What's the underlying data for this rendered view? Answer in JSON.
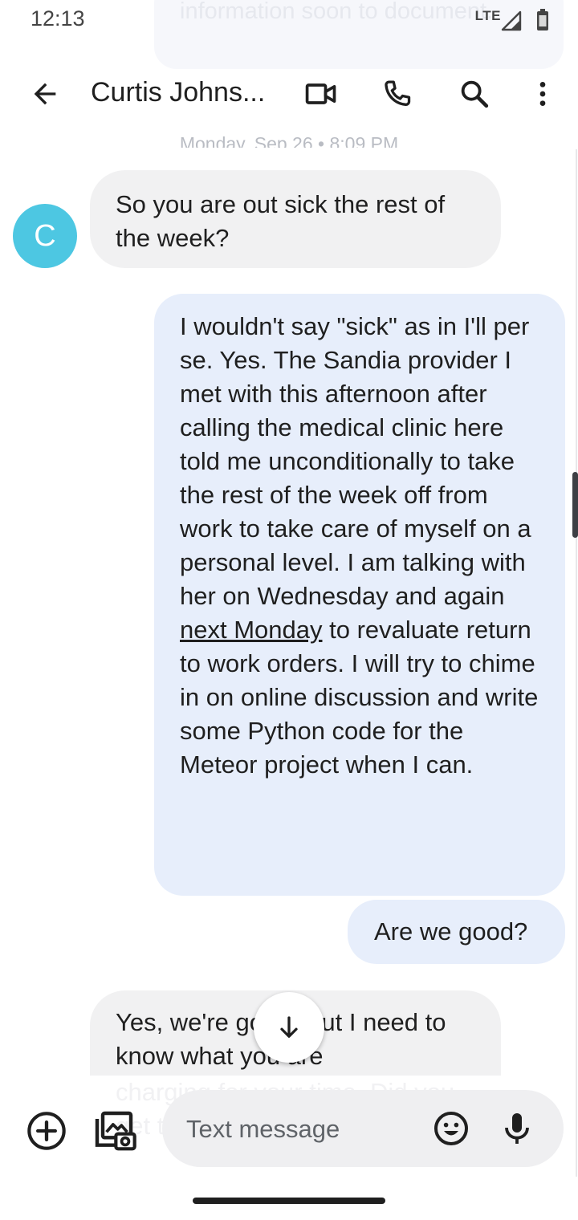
{
  "status_bar": {
    "time": "12:13",
    "network": "LTE"
  },
  "app_bar": {
    "contact_name": "Curtis Johns...",
    "icons": [
      "back-arrow-icon",
      "video-call-icon",
      "phone-icon",
      "search-icon",
      "more-vert-icon"
    ]
  },
  "conversation": {
    "faded_top_text": "information soon to document.",
    "timestamp": "Monday, Sep 26 • 8:09 PM",
    "avatar_initial": "C",
    "messages": [
      {
        "direction": "incoming",
        "text": "So you are out sick the rest of the week?"
      },
      {
        "direction": "outgoing",
        "text_before_link": "I wouldn't say \"sick\" as in I'll per se. Yes. The Sandia provider I met with this afternoon after calling the medical clinic here told me unconditionally to take the rest of the week off from work to take care of myself on a personal level. I am talking with her on Wednesday and again ",
        "link": "next Monday",
        "text_after_link": " to revaluate return to work orders. I will try to chime in on online discussion and write some Python code for the Meteor project when I can."
      },
      {
        "direction": "outgoing",
        "text": "Are we good?"
      },
      {
        "direction": "incoming",
        "text": "Yes, we're good. But I need to know what you are"
      }
    ],
    "faded_bottom_text": "charging for your time. Did you get the"
  },
  "compose": {
    "placeholder": "Text message"
  },
  "colors": {
    "avatar": "#4dc7e2",
    "incoming_bubble": "#f1f1f2",
    "outgoing_bubble": "#e7eefb"
  }
}
